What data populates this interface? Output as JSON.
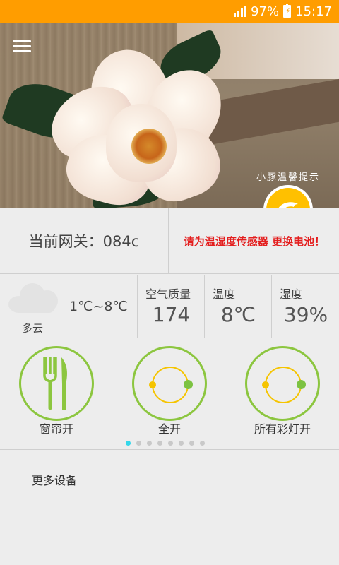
{
  "status_bar": {
    "battery": "97%",
    "time": "15:17"
  },
  "banner": {
    "tip_text": "小豚温馨提示"
  },
  "gateway": {
    "label": "当前网关：084c"
  },
  "alert": {
    "text": "请为温湿度传感器 更换电池！"
  },
  "weather": {
    "description": "多云",
    "temp_range": "1℃~8℃",
    "air_quality_label": "空气质量",
    "air_quality_value": "174",
    "temperature_label": "温度",
    "temperature_value": "8℃",
    "humidity_label": "湿度",
    "humidity_value": "39%"
  },
  "scenes": [
    {
      "label": "窗帘开",
      "icon": "fork-knife-icon"
    },
    {
      "label": "全开",
      "icon": "toggle-icon"
    },
    {
      "label": "所有彩灯开",
      "icon": "toggle-icon"
    }
  ],
  "pager": {
    "count": 8,
    "active": 0
  },
  "more": {
    "label": "更多设备"
  },
  "colors": {
    "status_bar": "#ff9d00",
    "accent_green": "#8cc63f",
    "alert_red": "#e41e1e",
    "badge_yellow": "#ffc000"
  }
}
